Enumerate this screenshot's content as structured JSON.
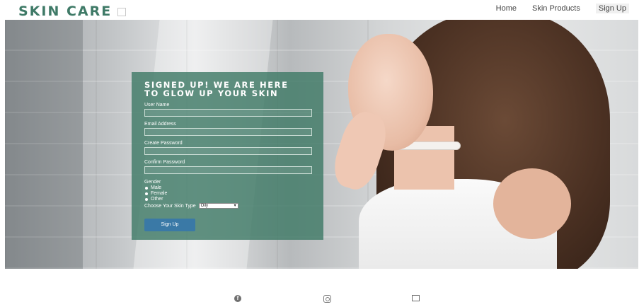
{
  "header": {
    "brand": "SKIN CARE",
    "nav": [
      "Home",
      "Skin Products",
      "Sign Up"
    ]
  },
  "form": {
    "title_line1": "SIGNED UP! WE ARE HERE",
    "title_line2": "TO GLOW UP YOUR SKIN",
    "fields": [
      "User Name",
      "Email Address",
      "Create Password",
      "Confirm Password"
    ],
    "gender_label": "Gender",
    "gender_options": [
      "Male",
      "Female",
      "Other"
    ],
    "skin_type_label": "Choose Your Skin Type",
    "skin_type_value": "Oily",
    "submit_label": "Sign Up"
  },
  "footer": {
    "icons": [
      "facebook-icon",
      "instagram-icon",
      "youtube-icon"
    ]
  },
  "colors": {
    "brand": "#3f7a67",
    "form_panel": "#3f7a67",
    "button": "#3a79a6"
  }
}
